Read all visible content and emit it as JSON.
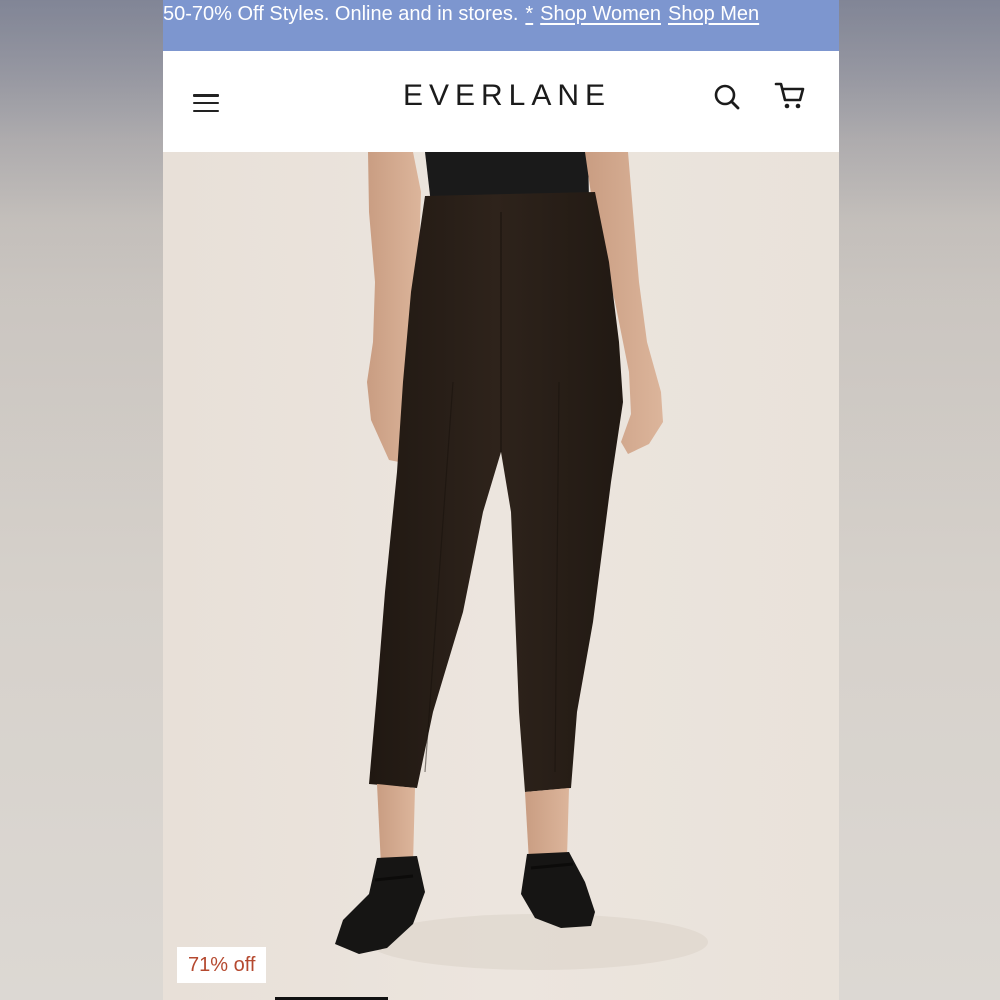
{
  "promo": {
    "text": "50-70% Off Styles. Online and in stores.",
    "asterisk_link": "*",
    "shop_women": "Shop Women",
    "shop_men": "Shop Men"
  },
  "header": {
    "logo": "EVERLANE",
    "icons": [
      "menu-icon",
      "search-icon",
      "cart-icon"
    ]
  },
  "product": {
    "image_subject": "model wearing dark brown cropped pants with black flats",
    "discount_badge": "71% off"
  },
  "colors": {
    "promo_bg": "#7d96cf",
    "badge_text": "#b5492f",
    "pants": "#2a2019"
  }
}
